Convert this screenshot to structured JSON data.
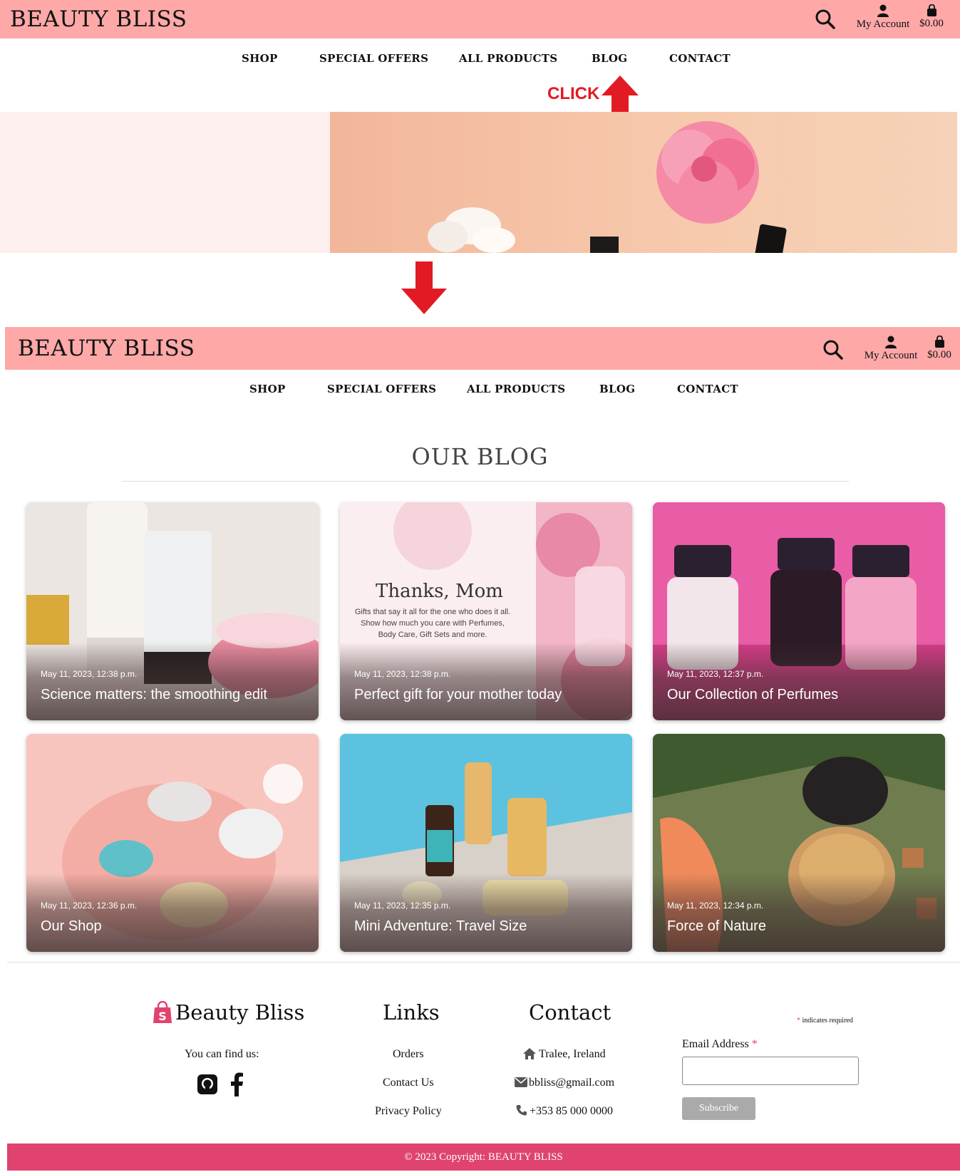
{
  "header": {
    "brand": "BEAUTY BLISS",
    "account_label": "My Account",
    "cart_total": "$0.00"
  },
  "nav": {
    "items": [
      "SHOP",
      "SPECIAL OFFERS",
      "ALL PRODUCTS",
      "BLOG",
      "CONTACT"
    ]
  },
  "annotation": {
    "click_label": "CLICK"
  },
  "blog": {
    "heading": "OUR BLOG",
    "posts": [
      {
        "date": "May 11, 2023, 12:38 p.m.",
        "title": "Science matters: the smoothing edit"
      },
      {
        "date": "May 11, 2023, 12:38 p.m.",
        "title": "Perfect gift for your mother today",
        "image_heading": "Thanks, Mom",
        "image_text_1": "Gifts that say it all for the one who does it all.",
        "image_text_2": "Show how much you care with Perfumes,",
        "image_text_3": "Body Care, Gift Sets and more."
      },
      {
        "date": "May 11, 2023, 12:37 p.m.",
        "title": "Our Collection of Perfumes"
      },
      {
        "date": "May 11, 2023, 12:36 p.m.",
        "title": "Our Shop"
      },
      {
        "date": "May 11, 2023, 12:35 p.m.",
        "title": "Mini Adventure: Travel Size"
      },
      {
        "date": "May 11, 2023, 12:34 p.m.",
        "title": "Force of Nature"
      }
    ]
  },
  "footer": {
    "brand": "Beauty Bliss",
    "find_us": "You can find us:",
    "links_heading": "Links",
    "links": [
      "Orders",
      "Contact Us",
      "Privacy Policy"
    ],
    "contact_heading": "Contact",
    "location": "Tralee, Ireland",
    "email": "bbliss@gmail.com",
    "phone": "+353 85 000 0000",
    "required_note": "indicates required",
    "email_label": "Email Address",
    "subscribe_label": "Subscribe",
    "copyright": "© 2023 Copyright: BEAUTY BLISS"
  },
  "colors": {
    "header_bg": "#fea8a8",
    "footer_bar": "#e0436f",
    "annotation_red": "#e21a23"
  }
}
